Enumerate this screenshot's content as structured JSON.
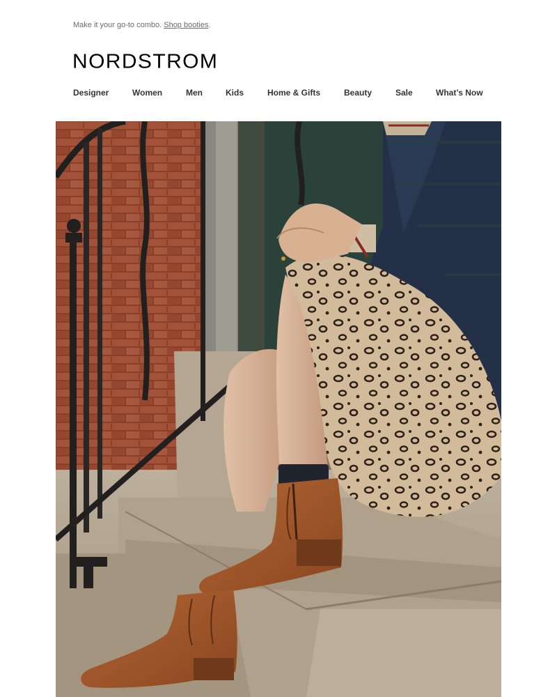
{
  "preheader": {
    "text": "Make it your go-to combo. ",
    "link_label": "Shop booties",
    "trailing": "."
  },
  "brand": {
    "logo_text": "NORDSTROM"
  },
  "nav": {
    "items": [
      {
        "label": "Designer"
      },
      {
        "label": "Women"
      },
      {
        "label": "Men"
      },
      {
        "label": "Kids"
      },
      {
        "label": "Home & Gifts"
      },
      {
        "label": "Beauty"
      },
      {
        "label": "Sale"
      },
      {
        "label": "What’s Now"
      }
    ]
  },
  "hero": {
    "icon": "hero-photo-booties",
    "colors": {
      "brick": "#9c4a32",
      "stone": "#b8ab98",
      "boot": "#a0582c",
      "railing": "#1e1e1e",
      "jacket": "#1f2f4a"
    }
  }
}
